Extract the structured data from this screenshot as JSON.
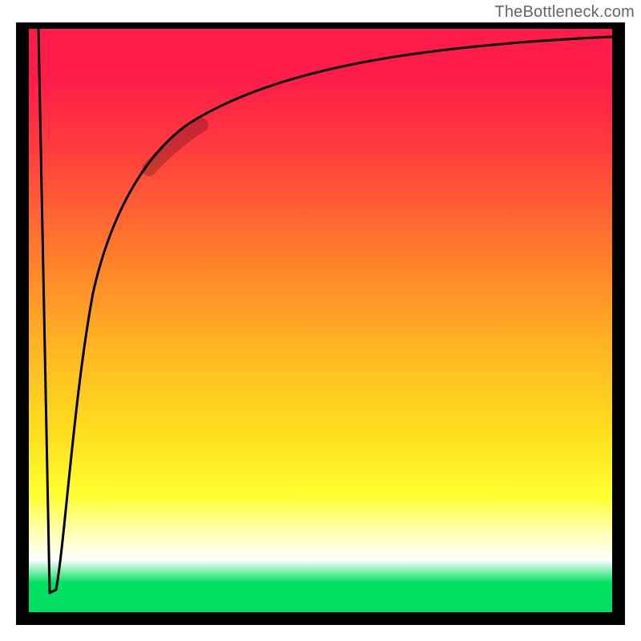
{
  "attribution": "TheBottleneck.com",
  "colors": {
    "frame": "#000000",
    "gradient_top": "#ff1b4a",
    "gradient_mid": "#ffe01e",
    "gradient_bottom": "#00e060",
    "curve": "#000000",
    "highlight": "rgba(0,0,0,0.22)"
  },
  "chart_data": {
    "type": "line",
    "title": "",
    "xlabel": "",
    "ylabel": "",
    "xlim": [
      0,
      100
    ],
    "ylim": [
      0,
      100
    ],
    "grid": false,
    "legend": false,
    "series": [
      {
        "name": "bottleneck-curve",
        "x": [
          1.6,
          3.5,
          4.7,
          6.2,
          7.7,
          11.0,
          13.7,
          19.2,
          27.5,
          41.2,
          63.2,
          100.0
        ],
        "y": [
          100,
          3.3,
          3.8,
          12.1,
          36.8,
          54.7,
          67.0,
          78.0,
          83.8,
          92.4,
          97.0,
          98.6
        ]
      }
    ],
    "annotations": [
      {
        "name": "highlight-segment",
        "x_range": [
          20.6,
          29.5
        ],
        "y_range": [
          76.0,
          83.5
        ]
      }
    ],
    "background": {
      "type": "vertical-gradient",
      "stops": [
        {
          "pos": 0.0,
          "color": "#ff1b4a"
        },
        {
          "pos": 0.08,
          "color": "#ff1b4a"
        },
        {
          "pos": 0.2,
          "color": "#ff3a3e"
        },
        {
          "pos": 0.38,
          "color": "#ff7a2c"
        },
        {
          "pos": 0.55,
          "color": "#ffb623"
        },
        {
          "pos": 0.7,
          "color": "#ffe01e"
        },
        {
          "pos": 0.8,
          "color": "#ffff30"
        },
        {
          "pos": 0.86,
          "color": "#ffffad"
        },
        {
          "pos": 0.91,
          "color": "#ffffff"
        },
        {
          "pos": 0.95,
          "color": "#00e060"
        },
        {
          "pos": 1.0,
          "color": "#00e060"
        }
      ]
    }
  }
}
